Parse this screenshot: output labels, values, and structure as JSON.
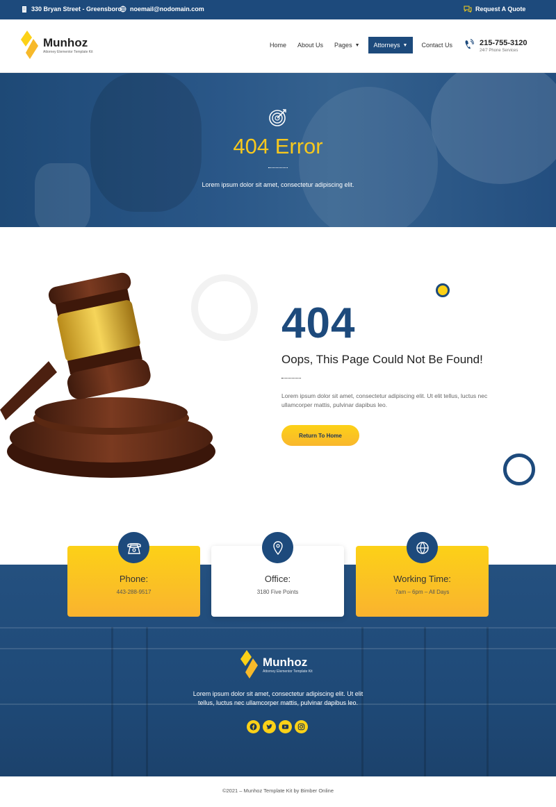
{
  "topbar": {
    "address": "330 Bryan Street - Greensboro",
    "email": "noemail@nodomain.com",
    "quote": "Request A Quote"
  },
  "brand": {
    "name": "Munhoz",
    "tagline": "Attorney Elementor Template Kit"
  },
  "nav": {
    "items": [
      "Home",
      "About Us",
      "Pages",
      "Attorneys",
      "Contact Us"
    ]
  },
  "phone": {
    "number": "215-755-3120",
    "sub": "24/7 Phone Services"
  },
  "hero": {
    "title": "404 Error",
    "subtitle": "Lorem ipsum dolor sit amet, consectetur adipiscing elit."
  },
  "error": {
    "code": "404",
    "title": "Oops, This Page Could Not Be Found!",
    "text": "Lorem ipsum dolor sit amet, consectetur adipiscing elit. Ut elit tellus, luctus nec ullamcorper mattis, pulvinar dapibus leo.",
    "button": "Return To Home"
  },
  "cards": [
    {
      "title": "Phone:",
      "value": "443-288-9517",
      "icon": "phone-icon"
    },
    {
      "title": "Office:",
      "value": "3180 Five Points",
      "icon": "location-pin-icon"
    },
    {
      "title": "Working Time:",
      "value": "7am – 6pm – All Days",
      "icon": "globe-icon"
    }
  ],
  "footer": {
    "text": "Lorem ipsum dolor sit amet, consectetur adipiscing elit. Ut elit tellus, luctus nec ullamcorper mattis, pulvinar dapibus leo.",
    "social": [
      "facebook-icon",
      "twitter-icon",
      "youtube-icon",
      "instagram-icon"
    ],
    "copyright": "©2021 – Munhoz Template Kit by Bimber Online"
  },
  "colors": {
    "primary": "#1d4a7c",
    "accent": "#fcd117"
  }
}
